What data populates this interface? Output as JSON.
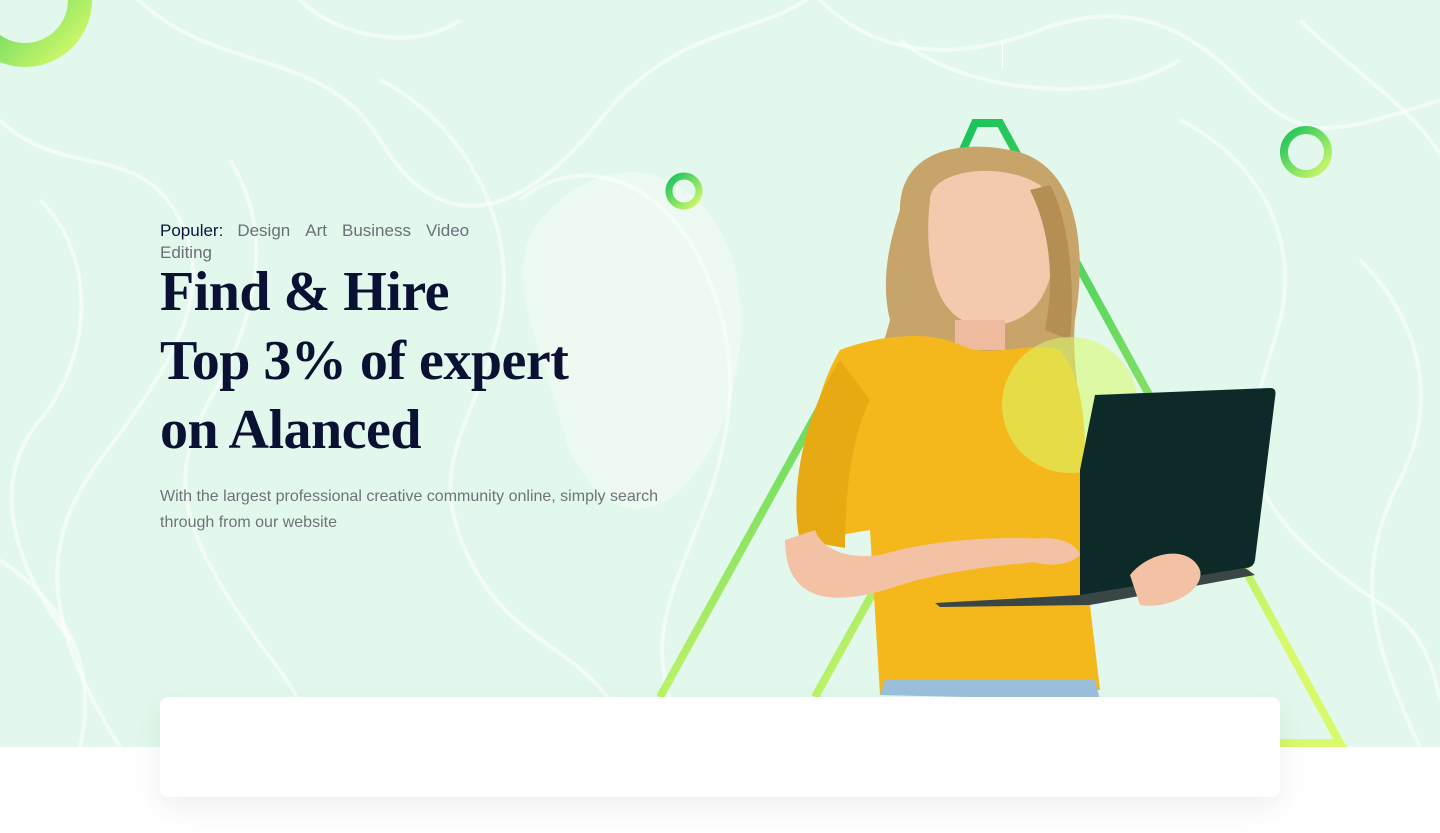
{
  "popular": {
    "label": "Populer:",
    "tags": [
      "Design",
      "Art",
      "Business",
      "Video Editing"
    ]
  },
  "hero": {
    "headline_lines": [
      "Find & Hire",
      "Top 3% of expert",
      "on Alanced"
    ],
    "subtext": "With the largest professional creative community online, simply search through from our website"
  },
  "colors": {
    "hero_background": "#e2f8ec",
    "accent_green": "#16c25a",
    "accent_lime": "#d8fa6a",
    "headline": "#0b1133",
    "shirt_yellow": "#f4b81c"
  },
  "icons": {
    "decor_ring_top_left": "ring-decoration",
    "decor_ring_small": "ring-decoration",
    "decor_ring_right": "ring-decoration",
    "triangles": "triangle-outline-decoration"
  },
  "images": {
    "hero_photo": "woman-with-laptop-illustration"
  }
}
